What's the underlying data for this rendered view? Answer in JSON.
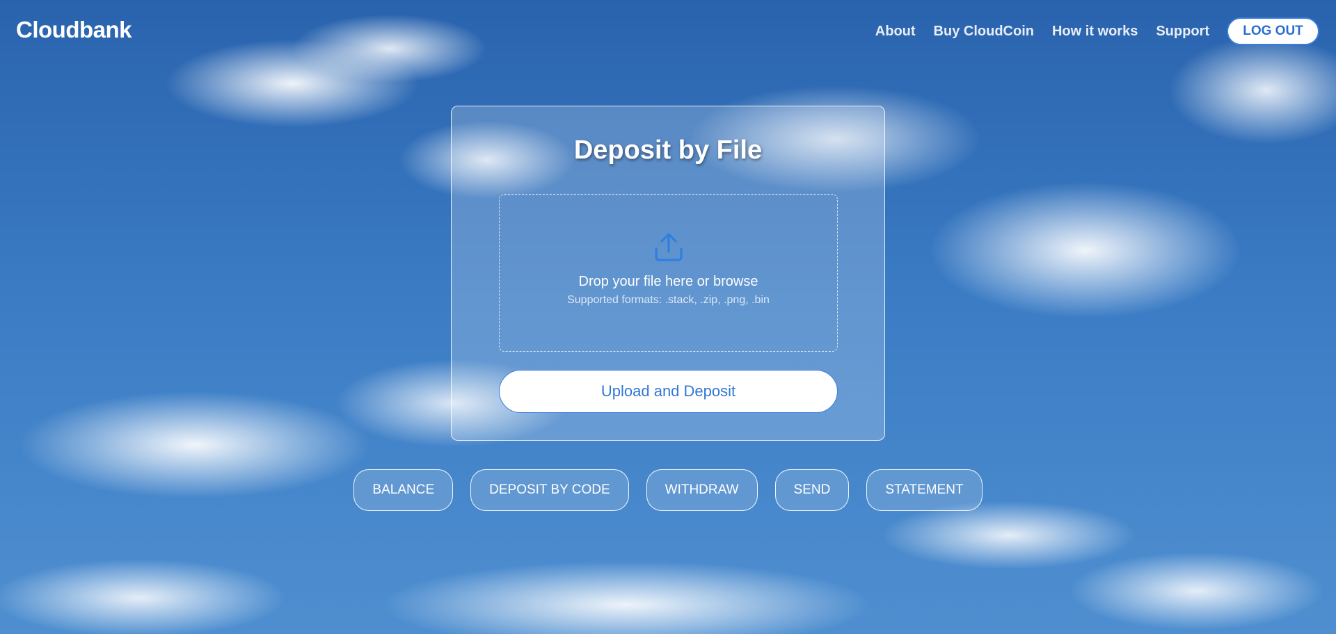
{
  "header": {
    "logo": "Cloudbank",
    "nav": [
      {
        "label": "About"
      },
      {
        "label": "Buy CloudCoin"
      },
      {
        "label": "How it works"
      },
      {
        "label": "Support"
      }
    ],
    "logout_label": "LOG OUT"
  },
  "deposit_card": {
    "title": "Deposit by File",
    "dropzone": {
      "icon": "upload-icon",
      "prompt": "Drop your file here or browse",
      "formats": "Supported formats: .stack, .zip, .png, .bin"
    },
    "upload_button_label": "Upload and Deposit"
  },
  "actions": [
    {
      "label": "BALANCE"
    },
    {
      "label": "DEPOSIT BY CODE"
    },
    {
      "label": "WITHDRAW"
    },
    {
      "label": "SEND"
    },
    {
      "label": "STATEMENT"
    }
  ],
  "colors": {
    "accent": "#2f77d6",
    "sky": "#3a7bc4",
    "white": "#ffffff"
  }
}
